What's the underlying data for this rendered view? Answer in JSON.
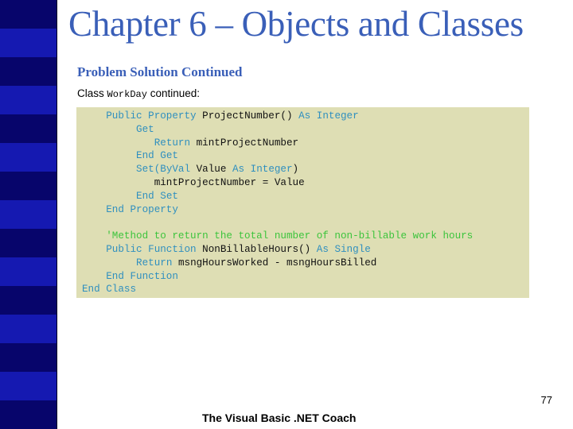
{
  "sidebar": {
    "stripe_count": 15,
    "colors": {
      "dark": "#07056b",
      "bright": "#1519b1"
    }
  },
  "slide": {
    "title": "Chapter 6 – Objects and Classes",
    "subtitle": "Problem Solution Continued",
    "caption": {
      "prefix": "Class ",
      "code": "WorkDay",
      "suffix": " continued:"
    },
    "code_lines": [
      [
        {
          "t": "    ",
          "c": "id"
        },
        {
          "t": "Public Property",
          "c": "kw"
        },
        {
          "t": " ProjectNumber() ",
          "c": "id"
        },
        {
          "t": "As Integer",
          "c": "kw"
        }
      ],
      [
        {
          "t": "         ",
          "c": "id"
        },
        {
          "t": "Get",
          "c": "kw"
        }
      ],
      [
        {
          "t": "            ",
          "c": "id"
        },
        {
          "t": "Return",
          "c": "kw"
        },
        {
          "t": " mintProjectNumber",
          "c": "id"
        }
      ],
      [
        {
          "t": "         ",
          "c": "id"
        },
        {
          "t": "End Get",
          "c": "kw"
        }
      ],
      [
        {
          "t": "         ",
          "c": "id"
        },
        {
          "t": "Set(ByVal",
          "c": "kw"
        },
        {
          "t": " Value ",
          "c": "id"
        },
        {
          "t": "As Integer",
          "c": "kw"
        },
        {
          "t": ")",
          "c": "id"
        }
      ],
      [
        {
          "t": "            mintProjectNumber = Value",
          "c": "id"
        }
      ],
      [
        {
          "t": "         ",
          "c": "id"
        },
        {
          "t": "End Set",
          "c": "kw"
        }
      ],
      [
        {
          "t": "    ",
          "c": "id"
        },
        {
          "t": "End Property",
          "c": "kw"
        }
      ],
      [
        {
          "t": "",
          "c": "id"
        }
      ],
      [
        {
          "t": "    ",
          "c": "id"
        },
        {
          "t": "'Method to return the total number of non-billable work hours",
          "c": "cm"
        }
      ],
      [
        {
          "t": "    ",
          "c": "id"
        },
        {
          "t": "Public Function",
          "c": "kw"
        },
        {
          "t": " NonBillableHours() ",
          "c": "id"
        },
        {
          "t": "As Single",
          "c": "kw"
        }
      ],
      [
        {
          "t": "         ",
          "c": "id"
        },
        {
          "t": "Return",
          "c": "kw"
        },
        {
          "t": " msngHoursWorked - msngHoursBilled",
          "c": "id"
        }
      ],
      [
        {
          "t": "    ",
          "c": "id"
        },
        {
          "t": "End Function",
          "c": "kw"
        }
      ],
      [
        {
          "t": "End Class",
          "c": "kw"
        }
      ]
    ],
    "page_number": "77",
    "footer": "The Visual Basic .NET Coach"
  },
  "colors": {
    "title": "#3a5fb8",
    "code_background": "#dedeb4",
    "keyword": "#2f8fbf",
    "comment": "#3cc43c"
  }
}
